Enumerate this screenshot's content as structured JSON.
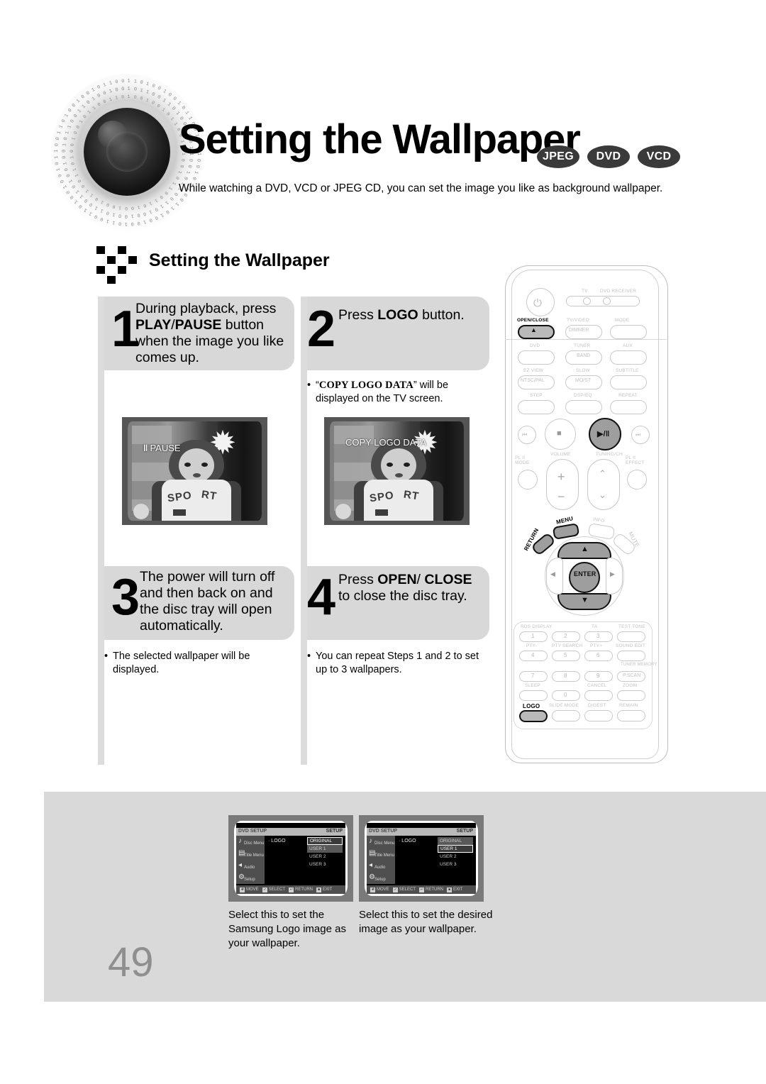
{
  "header": {
    "title": "Setting the Wallpaper",
    "badges": [
      "JPEG",
      "DVD",
      "VCD"
    ],
    "intro": "While watching a DVD, VCD or JPEG CD, you can set the image you like as background wallpaper."
  },
  "section": {
    "title": "Setting the Wallpaper"
  },
  "steps": [
    {
      "number": "1",
      "text_html": "During playback, press <b>PLAY</b>/<b>PAUSE</b> button when the image you like comes up."
    },
    {
      "number": "2",
      "text_html": "Press <b>LOGO</b> button."
    },
    {
      "number": "3",
      "text_html": "The power will turn off and then back on and the disc tray will open automatically."
    },
    {
      "number": "4",
      "text_html": "Press <b>OPEN</b>/ <b>CLOSE</b> to close the disc tray."
    }
  ],
  "notes": {
    "step2_html": "&ldquo;<span class=\"sc\">COPY LOGO DATA</span>&rdquo; will be displayed on the TV screen.",
    "step3_html": "The selected wallpaper will be displayed.",
    "step4_html": "You can repeat Steps 1 and 2 to set up to 3 wallpapers.",
    "bullet": "•"
  },
  "photos": {
    "photo1_osd": "PAUSE",
    "photo1_osd_icon": "‖",
    "photo2_osd": "COPY LOGO DATA",
    "jacket_left": "SPO",
    "jacket_right": "RT",
    "star_glyph": "✹"
  },
  "osd_screens": [
    {
      "title_left": "DVD SETUP",
      "title_right": "SETUP",
      "menu_items": [
        {
          "icon": "♪",
          "label": "Disc Menu"
        },
        {
          "icon": "▤",
          "label": "Title Menu"
        },
        {
          "icon": "◂",
          "label": "Audio"
        },
        {
          "icon": "⚙",
          "label": "Setup"
        }
      ],
      "field_label": "LOGO",
      "field_prefix": "·",
      "options": [
        "ORIGINAL",
        "USER 1",
        "USER 2",
        "USER 3"
      ],
      "selected": "ORIGINAL",
      "shaded": "USER 1",
      "footer": [
        {
          "key": "✥",
          "label": "MOVE"
        },
        {
          "key": "✓",
          "label": "SELECT"
        },
        {
          "key": "↩",
          "label": "RETURN"
        },
        {
          "key": "■",
          "label": "EXIT"
        }
      ],
      "caption": "Select this to set the Samsung Logo image as your wallpaper."
    },
    {
      "title_left": "DVD SETUP",
      "title_right": "SETUP",
      "menu_items": [
        {
          "icon": "♪",
          "label": "Disc Menu"
        },
        {
          "icon": "▤",
          "label": "Title Menu"
        },
        {
          "icon": "◂",
          "label": "Audio"
        },
        {
          "icon": "⚙",
          "label": "Setup"
        }
      ],
      "field_label": "LOGO",
      "field_prefix": "·",
      "options": [
        "ORIGINAL",
        "USER 1",
        "USER 2",
        "USER 3"
      ],
      "selected": "USER 1",
      "shaded": "ORIGINAL",
      "footer": [
        {
          "key": "✥",
          "label": "MOVE"
        },
        {
          "key": "✓",
          "label": "SELECT"
        },
        {
          "key": "↩",
          "label": "RETURN"
        },
        {
          "key": "■",
          "label": "EXIT"
        }
      ],
      "caption": "Select this to set the desired image as your wallpaper."
    }
  ],
  "remote": {
    "power_glyph": "⏻",
    "mode_switch": {
      "left": "TV",
      "right": "DVD RECEIVER"
    },
    "labels": {
      "open_close": "OPEN/CLOSE",
      "tv_video": "TV/VIDEO",
      "dimmer": "DIMMER",
      "mode": "MODE",
      "dvd": "DVD",
      "tuner": "TUNER",
      "band": "BAND",
      "aux": "AUX",
      "ez_view": "EZ VIEW",
      "ntsc_pal": "NTSC/PAL",
      "slow": "SLOW",
      "moist": "MO/ST",
      "subtitle": "SUBTITLE",
      "step": "STEP",
      "dsp_eq": "DSP/EQ",
      "repeat": "REPEAT",
      "volume": "VOLUME",
      "tuning_ch": "TUNING/CH",
      "pl2_mode": "PL II\nMODE",
      "pl2_effect": "PL II\nEFFECT",
      "menu": "MENU",
      "info": "INFO",
      "return": "RETURN",
      "mute": "MUTE",
      "enter": "ENTER",
      "rds_display": "RDS DISPLAY",
      "ta": "TA",
      "test_tone": "TEST TONE",
      "pty_minus": "PTY-",
      "pty_search": "PTY SEARCH",
      "pty_plus": "PTY+",
      "sound_edit": "SOUND EDIT",
      "tuner_memory": "TUNER MEMORY",
      "p_scan": "P.SCAN",
      "sleep": "SLEEP",
      "cancel": "CANCEL",
      "zoom": "ZOOM",
      "logo": "LOGO",
      "slide_mode": "SLIDE MODE",
      "digest": "DIGEST",
      "remain": "REMAIN"
    },
    "transport": {
      "prev": "⏮",
      "stop": "■",
      "play_pause": "▶/‖",
      "next": "⏭"
    },
    "numbers": [
      "1",
      "2",
      "3",
      "4",
      "5",
      "6",
      "7",
      "8",
      "9",
      "0"
    ],
    "highlighted_buttons": [
      "OPEN/CLOSE",
      "PLAY/PAUSE",
      "LOGO"
    ]
  },
  "page": {
    "number": "49"
  }
}
